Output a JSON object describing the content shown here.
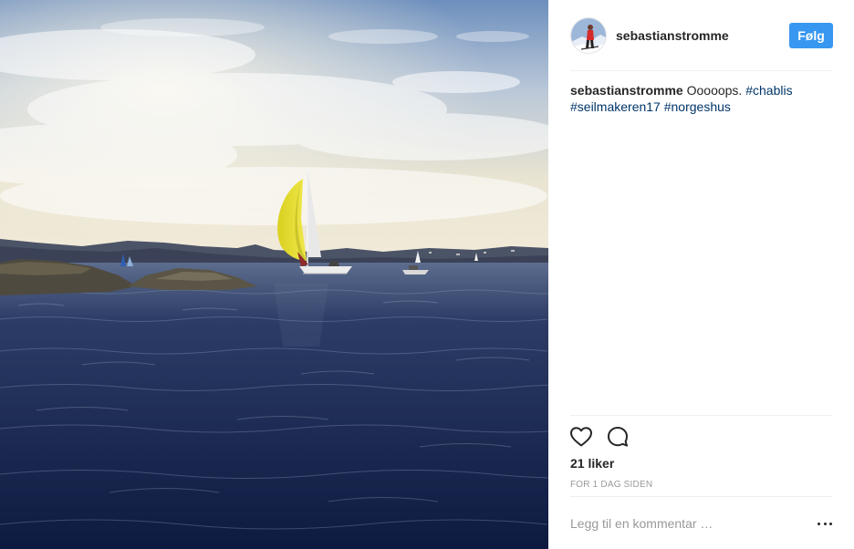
{
  "post": {
    "username": "sebastianstromme",
    "follow_label": "Følg",
    "caption": {
      "username": "sebastianstromme",
      "text": "Ooooops.",
      "hashtags": [
        "#chablis",
        "#seilmakeren17",
        "#norgeshus"
      ]
    },
    "likes": "21 liker",
    "timestamp": "FOR 1 DAG SIDEN",
    "comment_placeholder": "Legg til en kommentar …"
  },
  "icons": {
    "like": "heart-icon",
    "comment": "comment-icon",
    "more": "more-options-icon"
  },
  "colors": {
    "accent": "#3897f0",
    "hashtag": "#003569",
    "muted": "#999999",
    "text": "#262626",
    "sail": "#e6dc2a"
  }
}
